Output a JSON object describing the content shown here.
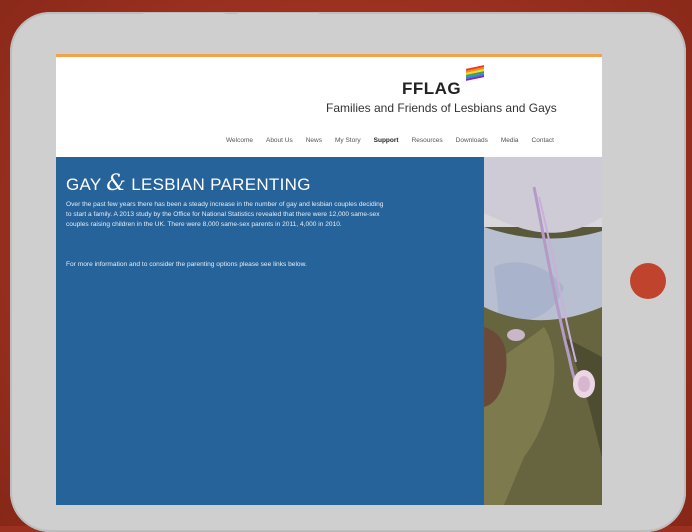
{
  "site": {
    "logo": "FFLAG",
    "org_name": "Families and Friends of Lesbians and Gays",
    "rainbow": [
      "#e53935",
      "#fb8c00",
      "#fdd835",
      "#43a047",
      "#1e88e5",
      "#8e24aa"
    ]
  },
  "nav": {
    "items": [
      {
        "label": "Welcome"
      },
      {
        "label": "About Us"
      },
      {
        "label": "News"
      },
      {
        "label": "My Story"
      },
      {
        "label": "Support"
      },
      {
        "label": "Resources"
      },
      {
        "label": "Downloads"
      },
      {
        "label": "Media"
      },
      {
        "label": "Contact"
      }
    ]
  },
  "hero": {
    "title_part1": "GAY",
    "title_amp": "&",
    "title_part2": "LESBIAN PARENTING",
    "body": "Over the past few years there has been a steady increase in the number of gay and lesbian couples deciding to start a family. A 2013 study by the Office for National Statistics revealed that there were 12,000 same-sex couples raising children in the UK. There were 8,000 same-sex parents in 2011, 4,000 in 2010.",
    "more": "For more information and to consider the parenting options please see links below."
  },
  "colors": {
    "hero_bg": "#25639a",
    "accent": "#f2a24a",
    "device_frame": "#cfcfcf",
    "home_button": "#c0442d",
    "background": "#9b3020"
  }
}
